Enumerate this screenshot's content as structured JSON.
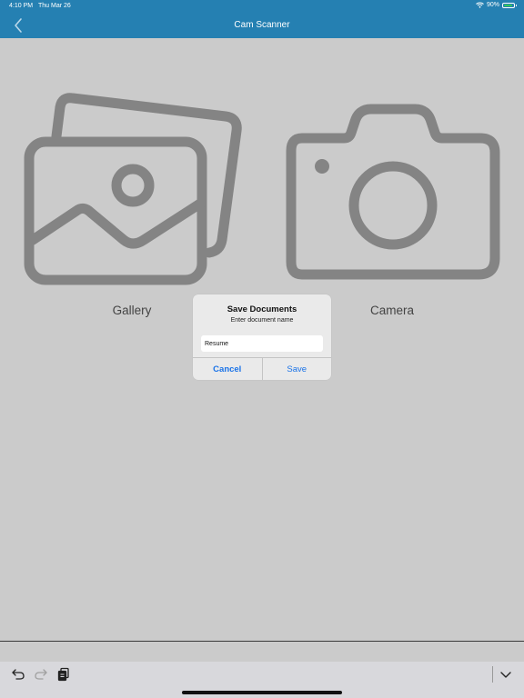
{
  "status_bar": {
    "time": "4:10 PM",
    "date": "Thu Mar 26",
    "battery": "90%",
    "battery_level": 0.9,
    "wifi_icon": "wifi-icon"
  },
  "nav": {
    "title": "Cam Scanner",
    "back_icon": "chevron-left-icon"
  },
  "options": {
    "gallery": {
      "label": "Gallery",
      "icon": "gallery-icon"
    },
    "camera": {
      "label": "Camera",
      "icon": "camera-icon"
    }
  },
  "dialog": {
    "title": "Save Documents",
    "message": "Enter document name",
    "input_value": "Resume",
    "cancel_label": "Cancel",
    "save_label": "Save"
  },
  "keyboard_toolbar": {
    "undo_icon": "undo-icon",
    "redo_icon": "redo-icon",
    "paste_icon": "paste-icon",
    "dismiss_icon": "chevron-down-icon"
  },
  "colors": {
    "header": "#2580b2",
    "background": "#cbcbcb",
    "icon_gray": "#848484",
    "dialog_button": "#1a73e8"
  }
}
